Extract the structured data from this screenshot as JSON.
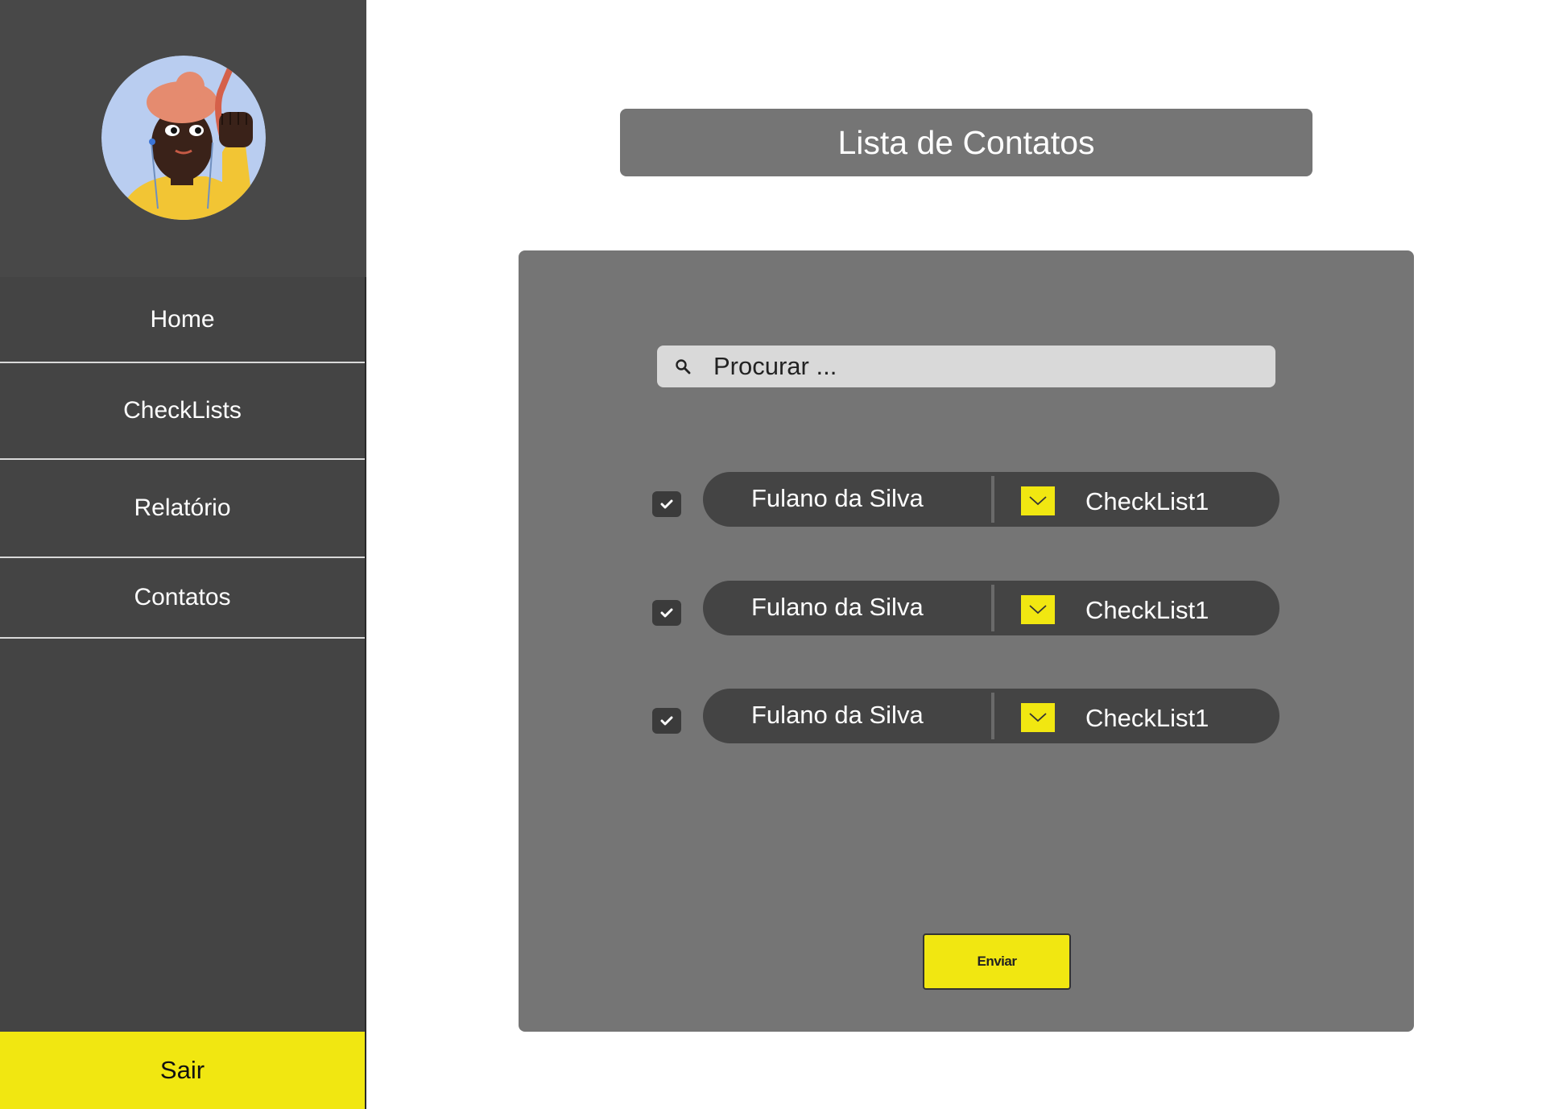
{
  "sidebar": {
    "nav": [
      {
        "label": "Home"
      },
      {
        "label": "CheckLists"
      },
      {
        "label": "Relatório"
      },
      {
        "label": "Contatos"
      }
    ],
    "logout_label": "Sair"
  },
  "header": {
    "title": "Lista de Contatos"
  },
  "search": {
    "placeholder": "Procurar ...",
    "icon": "search-icon"
  },
  "contacts": [
    {
      "name": "Fulano da Silva",
      "checklist": "CheckList1",
      "checked": true
    },
    {
      "name": "Fulano da Silva",
      "checklist": "CheckList1",
      "checked": true
    },
    {
      "name": "Fulano da Silva",
      "checklist": "CheckList1",
      "checked": true
    }
  ],
  "actions": {
    "send_label": "Enviar"
  },
  "colors": {
    "accent": "#f1e711",
    "sidebar": "#444444",
    "panel": "#757575",
    "search_bg": "#d9d9d9"
  }
}
